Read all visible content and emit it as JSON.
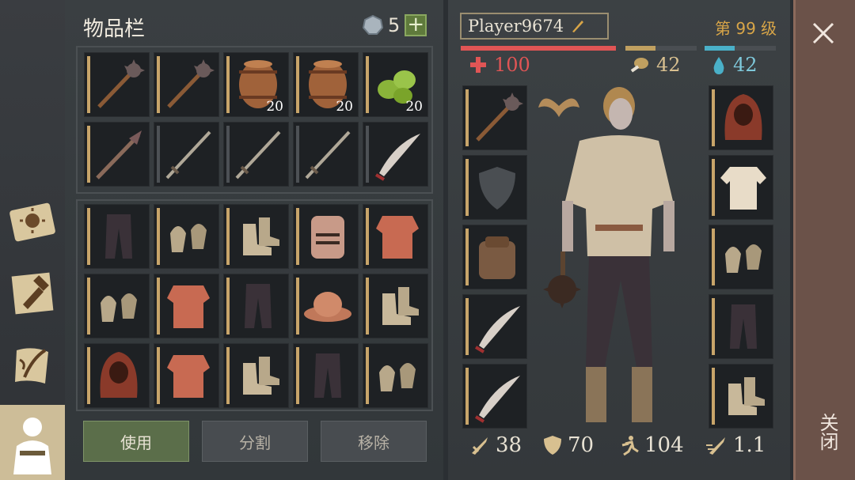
{
  "inventory": {
    "title": "物品栏",
    "coins": "5",
    "coin_add": "+",
    "rows": [
      [
        {
          "item": "mace",
          "qty": ""
        },
        {
          "item": "mace",
          "qty": ""
        },
        {
          "item": "barrel",
          "qty": "20"
        },
        {
          "item": "barrel",
          "qty": "20"
        },
        {
          "item": "herbs",
          "qty": "20"
        }
      ],
      [
        {
          "item": "spiked-club",
          "qty": ""
        },
        {
          "item": "sword",
          "qty": ""
        },
        {
          "item": "sword",
          "qty": ""
        },
        {
          "item": "sword",
          "qty": ""
        },
        {
          "item": "scimitar",
          "qty": ""
        }
      ],
      [
        {
          "item": "pants",
          "qty": ""
        },
        {
          "item": "gloves",
          "qty": ""
        },
        {
          "item": "boots",
          "qty": ""
        },
        {
          "item": "helmet",
          "qty": ""
        },
        {
          "item": "chainmail",
          "qty": ""
        }
      ],
      [
        {
          "item": "gloves",
          "qty": ""
        },
        {
          "item": "chainmail",
          "qty": ""
        },
        {
          "item": "pants",
          "qty": ""
        },
        {
          "item": "hat",
          "qty": ""
        },
        {
          "item": "boots",
          "qty": ""
        }
      ],
      [
        {
          "item": "hood",
          "qty": ""
        },
        {
          "item": "chainmail",
          "qty": ""
        },
        {
          "item": "boots",
          "qty": ""
        },
        {
          "item": "pants",
          "qty": ""
        },
        {
          "item": "gloves",
          "qty": ""
        }
      ]
    ],
    "actions": {
      "use": "使用",
      "split": "分割",
      "remove": "移除"
    }
  },
  "character": {
    "name": "Player9674",
    "level": "第 99 级",
    "health": "100",
    "food": "42",
    "water": "42",
    "health_pct": 1.0,
    "food_pct": 0.42,
    "water_pct": 0.42,
    "left_slots": [
      "mace",
      "shield-empty",
      "backpack",
      "scimitar",
      "scimitar"
    ],
    "right_slots": [
      "hood",
      "shirt",
      "gloves",
      "pants",
      "boots"
    ],
    "stats": {
      "attack": "38",
      "defense": "70",
      "speed": "104",
      "attack_speed": "1.1"
    }
  },
  "close_label": "关闭",
  "colors": {
    "accent": "#c8a56a",
    "health": "#e05555",
    "food": "#c0a060",
    "water": "#4ab0c8",
    "level": "#d8a548"
  }
}
